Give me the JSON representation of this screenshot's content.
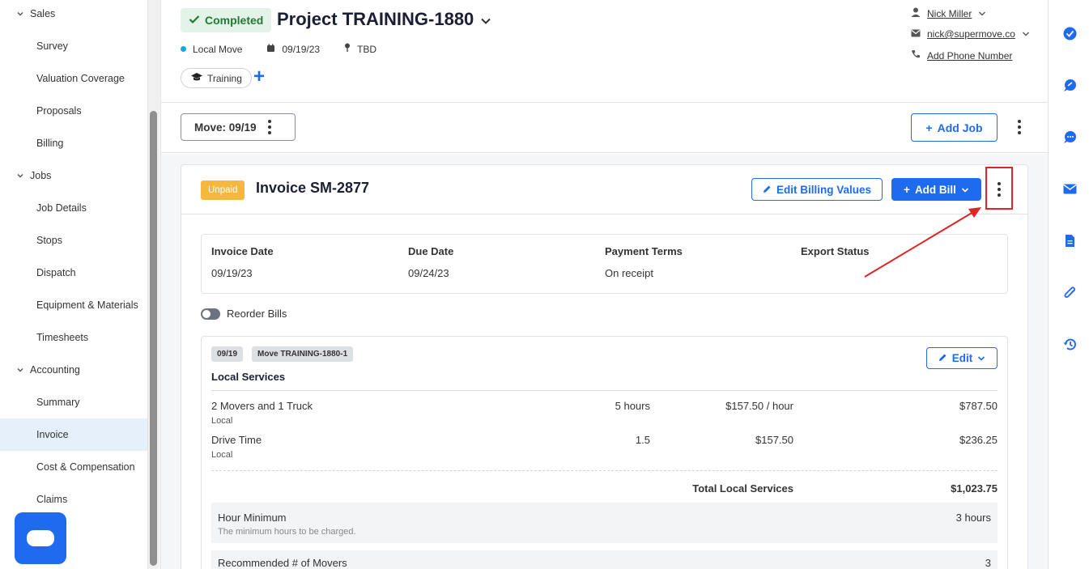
{
  "sidebar": {
    "groups": [
      {
        "label": "Sales",
        "items": [
          "Survey",
          "Valuation Coverage",
          "Proposals",
          "Billing"
        ]
      },
      {
        "label": "Jobs",
        "items": [
          "Job Details",
          "Stops",
          "Dispatch",
          "Equipment & Materials",
          "Timesheets"
        ]
      },
      {
        "label": "Accounting",
        "items": [
          "Summary",
          "Invoice",
          "Cost & Compensation",
          "Claims"
        ]
      }
    ],
    "active_item": "Invoice"
  },
  "header": {
    "status": "Completed",
    "project_title": "Project TRAINING-1880",
    "move_type": "Local Move",
    "date": "09/19/23",
    "location": "TBD",
    "tag": "Training",
    "contact": {
      "name": "Nick Miller",
      "email": "nick@supermove.co",
      "phone_action": "Add Phone Number"
    }
  },
  "move_bar": {
    "move_label": "Move: 09/19",
    "add_job_label": "Add Job"
  },
  "invoice": {
    "status": "Unpaid",
    "title": "Invoice SM-2877",
    "edit_billing_label": "Edit Billing Values",
    "add_bill_label": "Add Bill",
    "fields": {
      "invoice_date_label": "Invoice Date",
      "invoice_date": "09/19/23",
      "due_date_label": "Due Date",
      "due_date": "09/24/23",
      "payment_terms_label": "Payment Terms",
      "payment_terms": "On receipt",
      "export_status_label": "Export Status",
      "export_status": ""
    },
    "reorder_label": "Reorder Bills"
  },
  "bill": {
    "date_badge": "09/19",
    "job_badge": "Move TRAINING-1880-1",
    "edit_label": "Edit",
    "section_title": "Local Services",
    "items": [
      {
        "name": "2 Movers and 1 Truck",
        "sub": "Local",
        "qty": "5 hours",
        "rate": "$157.50 / hour",
        "amount": "$787.50"
      },
      {
        "name": "Drive Time",
        "sub": "Local",
        "qty": "1.5",
        "rate": "$157.50",
        "amount": "$236.25"
      }
    ],
    "total_label": "Total Local Services",
    "total_value": "$1,023.75",
    "hour_minimum": {
      "label": "Hour Minimum",
      "desc": "The minimum hours to be charged.",
      "value": "3 hours"
    },
    "recommended_movers": {
      "label": "Recommended # of Movers",
      "value": "3"
    }
  },
  "colors": {
    "accent": "#1f6bf0",
    "completed_bg": "#e4f3e7",
    "completed_text": "#1f7a34",
    "unpaid": "#f5b83d",
    "highlight": "#e02424"
  },
  "rail_icons": [
    "check-circle-icon",
    "chat-bubble-icon",
    "sms-icon",
    "mail-icon",
    "document-icon",
    "paperclip-icon",
    "history-icon"
  ]
}
